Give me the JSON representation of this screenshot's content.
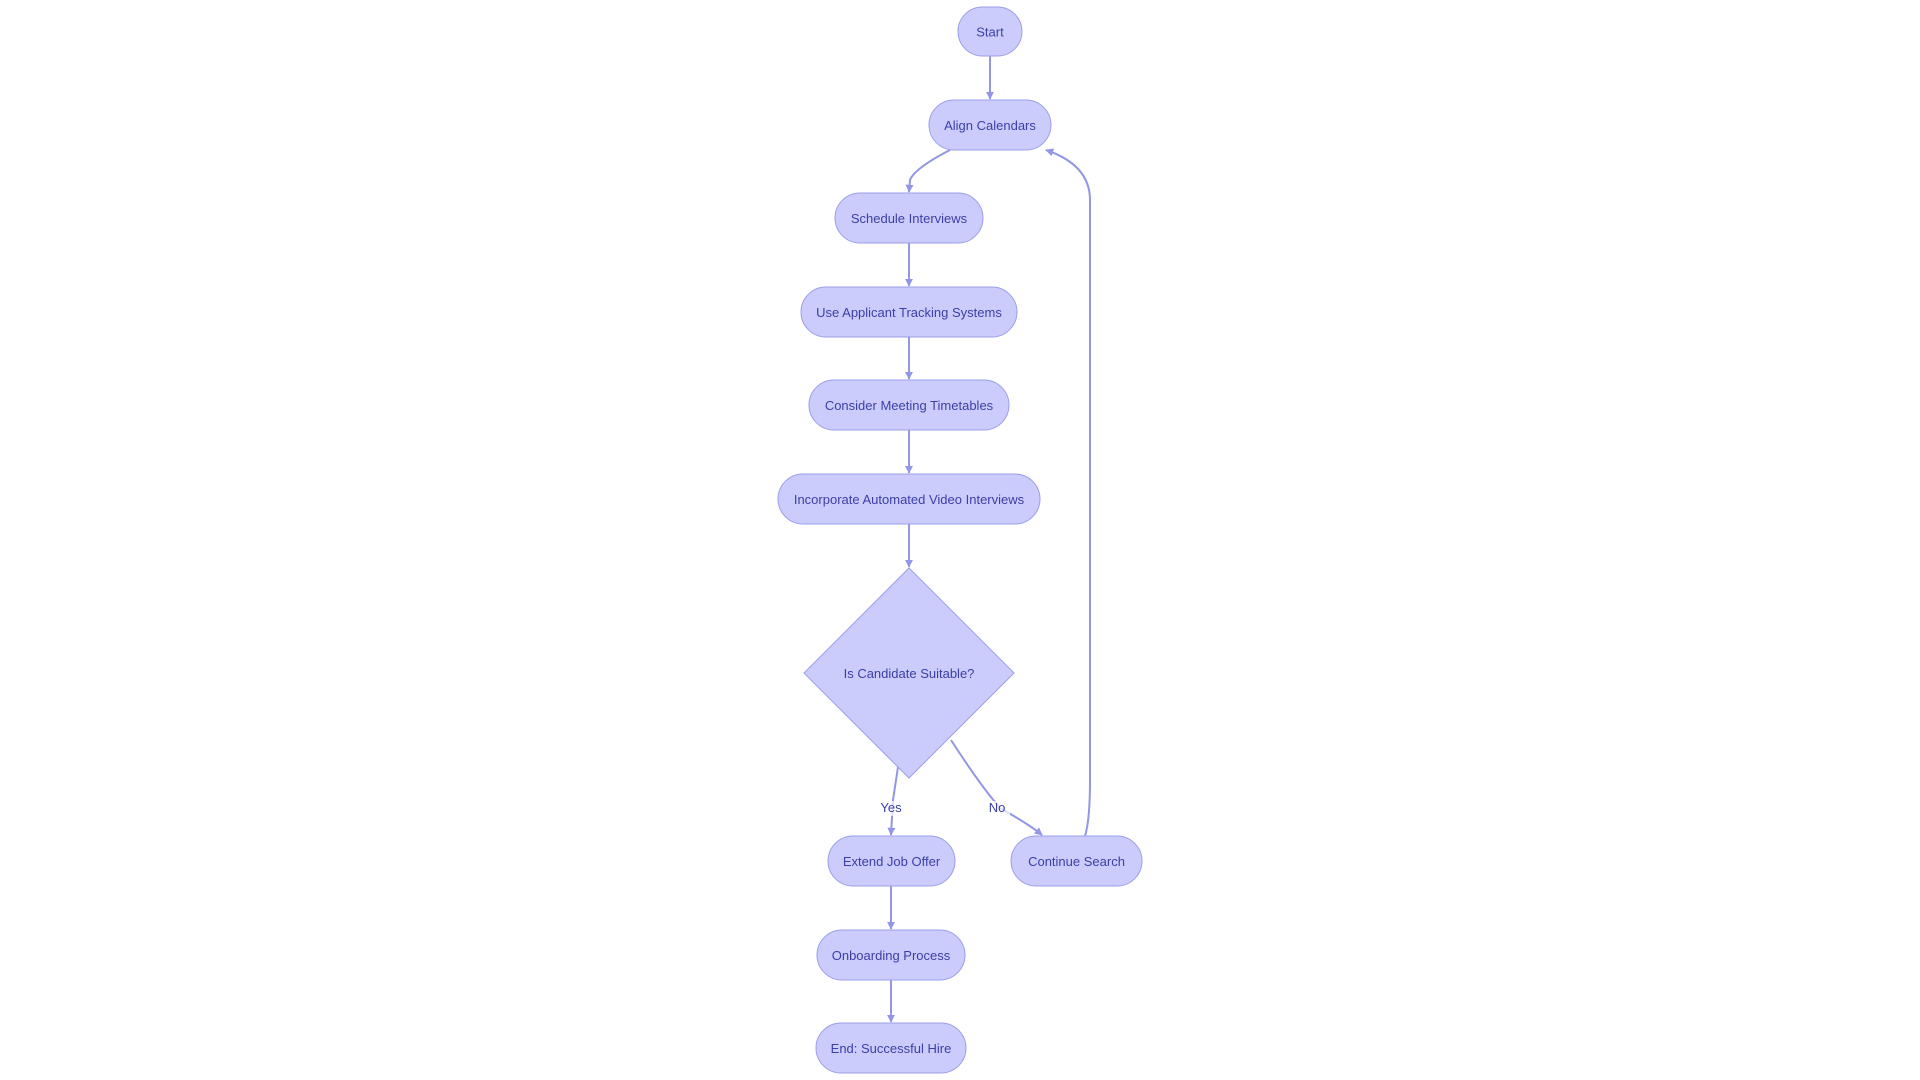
{
  "diagram": {
    "type": "flowchart",
    "colors": {
      "node_fill": "#cbccfb",
      "node_stroke": "#9b9eea",
      "edge": "#9296e4",
      "text": "#3b3fa6",
      "background": "#ffffff"
    },
    "nodes": [
      {
        "id": "start",
        "label": "Start",
        "shape": "stadium"
      },
      {
        "id": "align",
        "label": "Align Calendars",
        "shape": "stadium"
      },
      {
        "id": "schedule",
        "label": "Schedule Interviews",
        "shape": "stadium"
      },
      {
        "id": "ats",
        "label": "Use Applicant Tracking Systems",
        "shape": "stadium"
      },
      {
        "id": "timetables",
        "label": "Consider Meeting Timetables",
        "shape": "stadium"
      },
      {
        "id": "video",
        "label": "Incorporate Automated Video Interviews",
        "shape": "stadium"
      },
      {
        "id": "suitable",
        "label": "Is Candidate Suitable?",
        "shape": "diamond"
      },
      {
        "id": "offer",
        "label": "Extend Job Offer",
        "shape": "stadium"
      },
      {
        "id": "search",
        "label": "Continue Search",
        "shape": "stadium"
      },
      {
        "id": "onboarding",
        "label": "Onboarding Process",
        "shape": "stadium"
      },
      {
        "id": "end",
        "label": "End: Successful Hire",
        "shape": "stadium"
      }
    ],
    "edges": [
      {
        "from": "start",
        "to": "align",
        "label": ""
      },
      {
        "from": "align",
        "to": "schedule",
        "label": ""
      },
      {
        "from": "schedule",
        "to": "ats",
        "label": ""
      },
      {
        "from": "ats",
        "to": "timetables",
        "label": ""
      },
      {
        "from": "timetables",
        "to": "video",
        "label": ""
      },
      {
        "from": "video",
        "to": "suitable",
        "label": ""
      },
      {
        "from": "suitable",
        "to": "offer",
        "label": "Yes"
      },
      {
        "from": "suitable",
        "to": "search",
        "label": "No"
      },
      {
        "from": "search",
        "to": "align",
        "label": ""
      },
      {
        "from": "offer",
        "to": "onboarding",
        "label": ""
      },
      {
        "from": "onboarding",
        "to": "end",
        "label": ""
      }
    ]
  }
}
